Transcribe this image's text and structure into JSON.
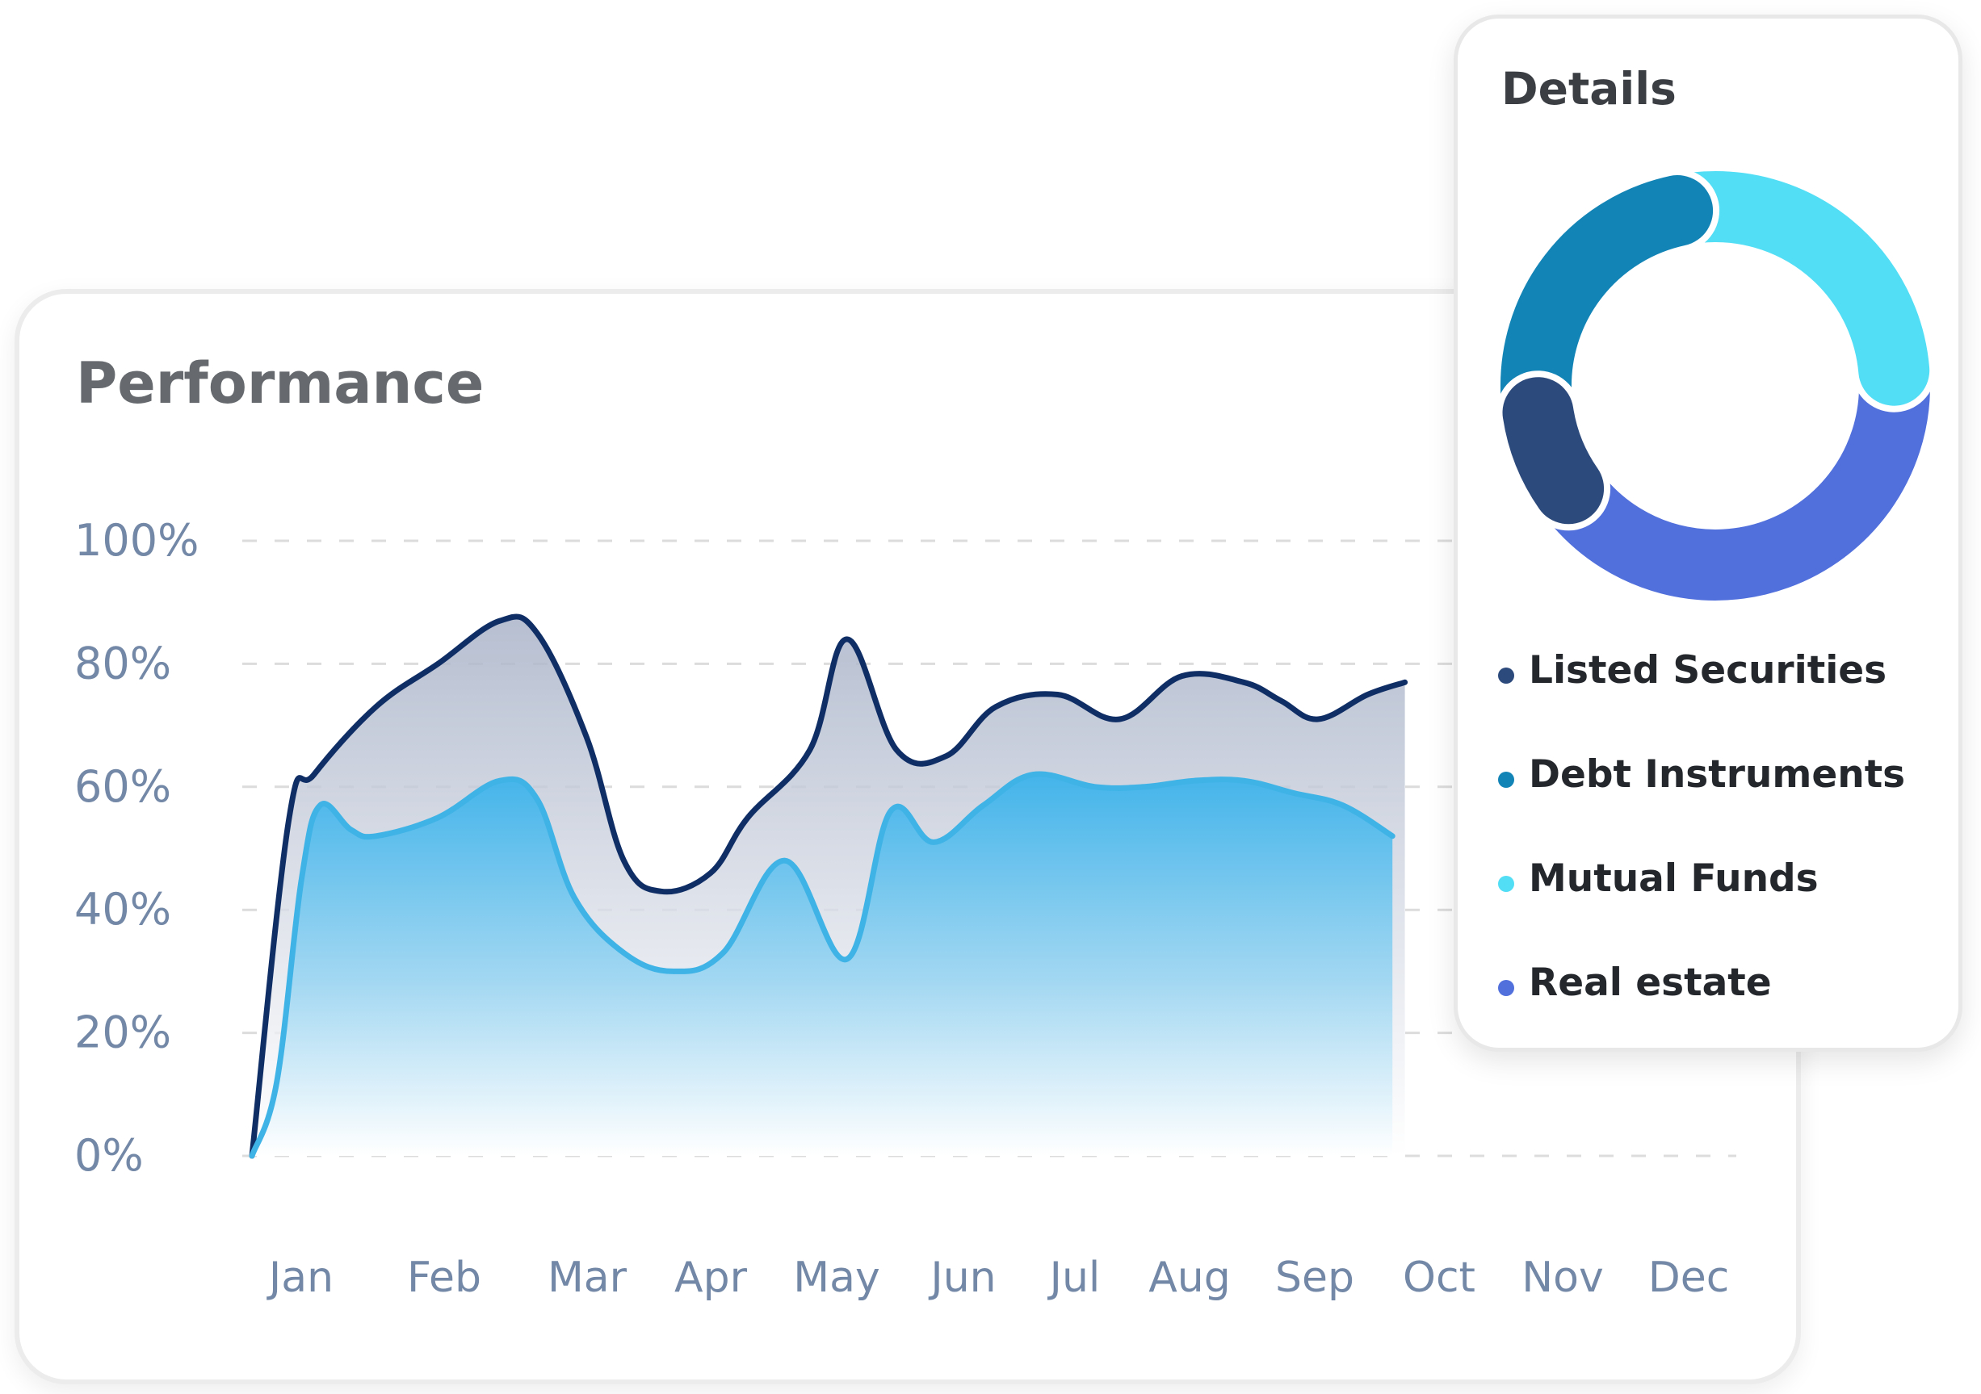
{
  "performance": {
    "title": "Performance"
  },
  "details": {
    "title": "Details",
    "legend": [
      {
        "label": "Listed Securities",
        "color": "#2d4a7c"
      },
      {
        "label": "Debt Instruments",
        "color": "#1384b6"
      },
      {
        "label": "Mutual Funds",
        "color": "#52def5"
      },
      {
        "label": "Real estate",
        "color": "#5270dc"
      }
    ]
  },
  "chart_data": [
    {
      "type": "area",
      "title": "Performance",
      "categories": [
        "Jan",
        "Feb",
        "Mar",
        "Apr",
        "May",
        "Jun",
        "Jul",
        "Aug",
        "Sep",
        "Oct",
        "Nov",
        "Dec"
      ],
      "y_tick_labels": [
        "0%",
        "20%",
        "40%",
        "60%",
        "80%",
        "100%"
      ],
      "ylim": [
        0,
        100
      ],
      "grid": true,
      "series": [
        {
          "color": "#102e66",
          "x": [
            0,
            0.3,
            0.5,
            1.0,
            1.5,
            2.0,
            2.3,
            2.7,
            3.0,
            3.3,
            3.7,
            4.0,
            4.5,
            4.8,
            5.2,
            5.6,
            6.0,
            6.5,
            7.0,
            7.5,
            8.0,
            8.3,
            8.6,
            9.0,
            9.3
          ],
          "values": [
            0,
            55,
            62,
            73,
            80,
            87,
            85,
            68,
            48,
            43,
            46,
            55,
            66,
            84,
            66,
            65,
            73,
            75,
            71,
            78,
            77,
            74,
            71,
            75,
            77
          ]
        },
        {
          "color": "#3fb3e6",
          "x": [
            0,
            0.2,
            0.4,
            0.55,
            0.8,
            1.0,
            1.5,
            2.0,
            2.3,
            2.6,
            3.0,
            3.4,
            3.8,
            4.3,
            4.8,
            5.15,
            5.5,
            5.9,
            6.3,
            6.8,
            7.2,
            7.6,
            8.0,
            8.4,
            8.8,
            9.2
          ],
          "values": [
            0,
            12,
            45,
            57,
            53,
            52,
            55,
            61,
            58,
            42,
            33,
            30,
            33,
            48,
            32,
            56,
            51,
            57,
            62,
            60,
            60,
            61,
            61,
            59,
            57,
            52
          ]
        }
      ]
    },
    {
      "type": "pie",
      "title": "Details",
      "categories": [
        "Listed Securities",
        "Debt Instruments",
        "Mutual Funds",
        "Real estate"
      ],
      "values": [
        9,
        24,
        27,
        40
      ]
    }
  ]
}
